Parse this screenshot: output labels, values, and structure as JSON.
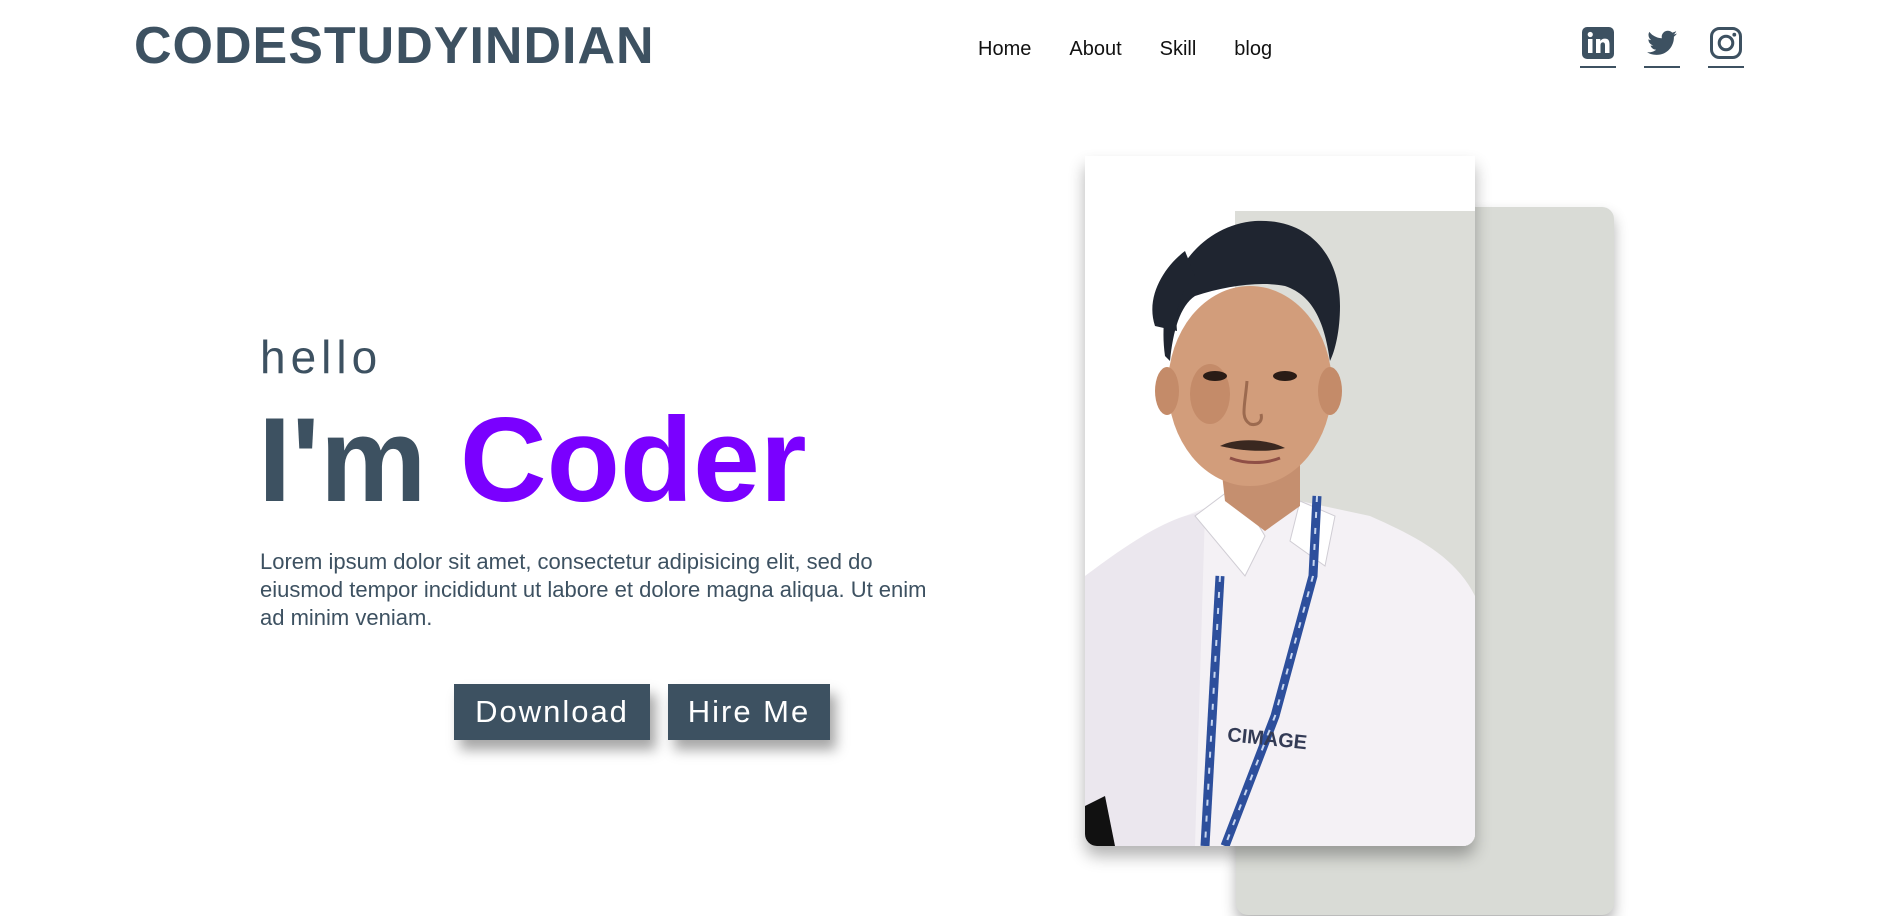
{
  "header": {
    "logo": "CODESTUDYINDIAN",
    "nav": [
      "Home",
      "About",
      "Skill",
      "blog"
    ],
    "socials": [
      "linkedin-icon",
      "twitter-icon",
      "instagram-icon"
    ]
  },
  "hero": {
    "greeting": "hello",
    "headline_prefix": "I'm",
    "headline_accent": "Coder",
    "description": "Lorem ipsum dolor sit amet, consectetur adipisicing elit, sed do eiusmod tempor incididunt ut labore et dolore magna aliqua. Ut enim ad minim veniam.",
    "download_label": "Download",
    "hire_label": "Hire Me"
  },
  "photo": {
    "badge_text": "CIMAGE"
  },
  "colors": {
    "primary": "#3d5161",
    "accent": "#7a00ff",
    "card_back": "#d9dbd6"
  }
}
